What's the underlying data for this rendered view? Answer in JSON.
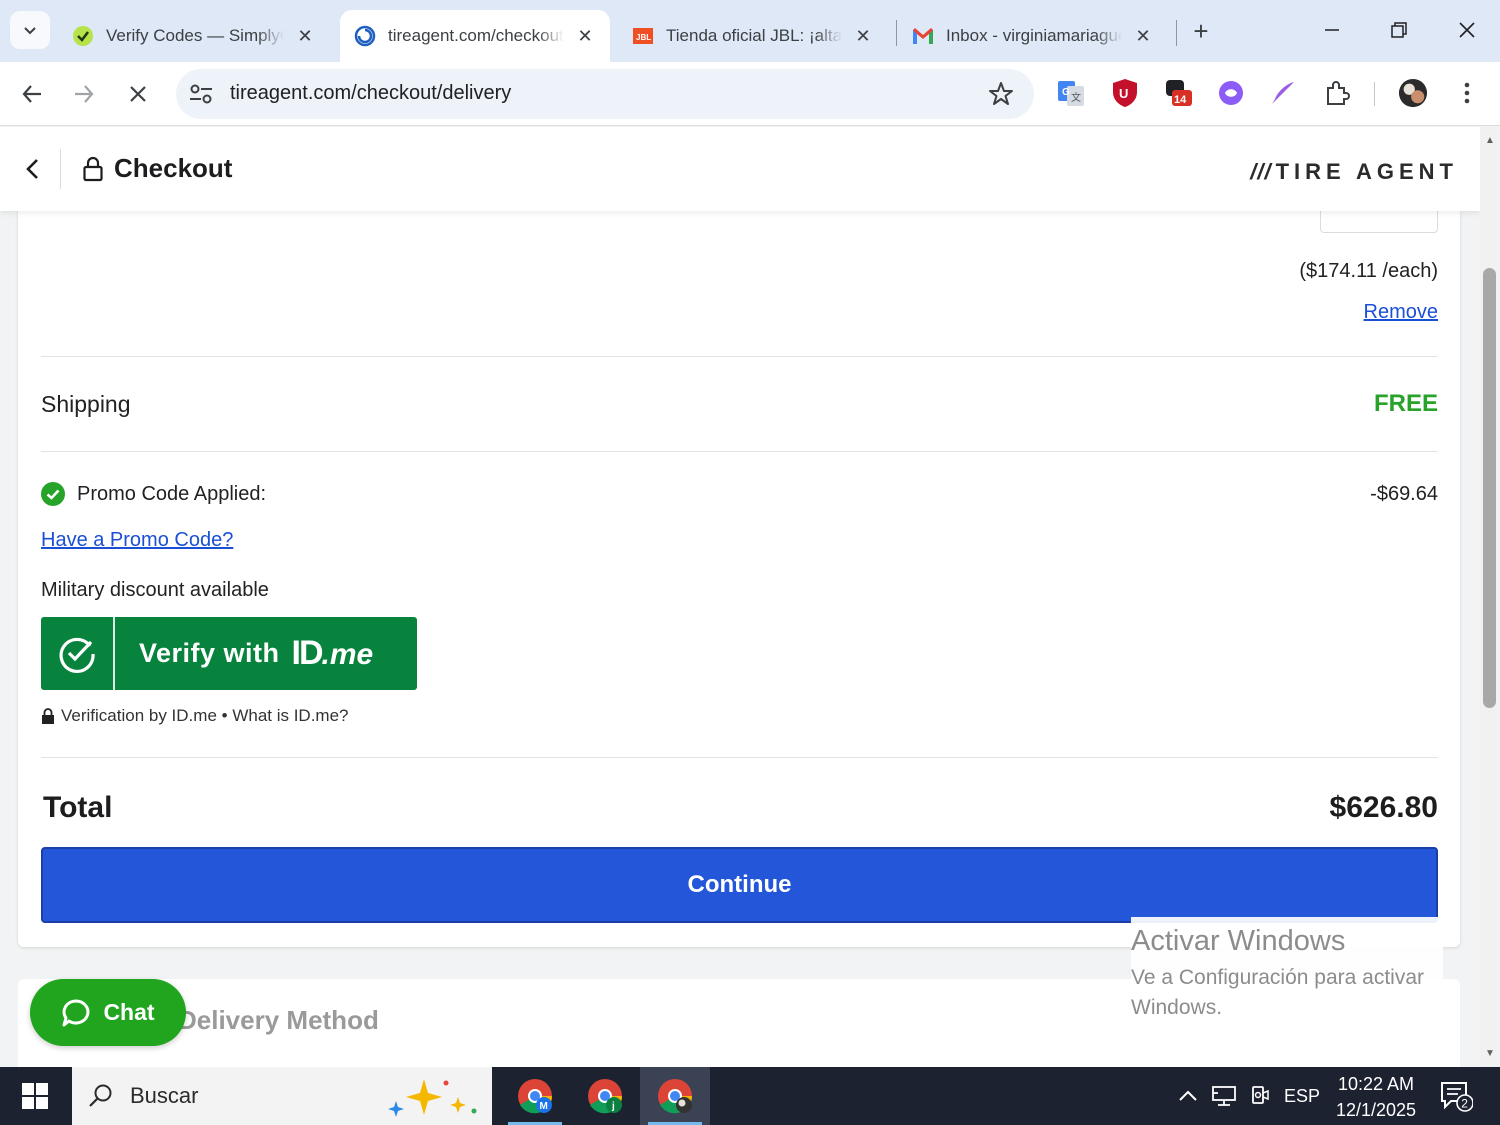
{
  "browser": {
    "tabs": [
      {
        "title": "Verify Codes — SimplyCodes",
        "active": false
      },
      {
        "title": "tireagent.com/checkout/delivery",
        "active": true
      },
      {
        "title": "Tienda oficial JBL: ¡alta calidad!",
        "active": false
      },
      {
        "title": "Inbox - virginiamariague",
        "active": false
      }
    ],
    "url": "tireagent.com/checkout/delivery",
    "extension_badge": "14"
  },
  "header": {
    "title": "Checkout",
    "brand_slashes": "///",
    "brand_name": "TIRE AGENT"
  },
  "order": {
    "price_each": "($174.11 /each)",
    "remove_label": "Remove",
    "shipping_label": "Shipping",
    "shipping_value": "FREE",
    "promo_applied_label": "Promo Code Applied:",
    "promo_amount": "-$69.64",
    "promo_link": "Have a Promo Code?",
    "military_text": "Military discount available",
    "idme_button_label": "Verify with",
    "idme_logo_id": "ID",
    "idme_logo_me": ".me",
    "idme_footer_verification": "Verification by ID.me",
    "idme_footer_sep": " • ",
    "idme_footer_whatis": "What is ID.me?",
    "total_label": "Total",
    "total_value": "$626.80",
    "continue_label": "Continue"
  },
  "next_section": {
    "title": "Delivery Method"
  },
  "chat": {
    "label": "Chat"
  },
  "windows_notice": {
    "title": "Activar Windows",
    "body": "Ve a Configuración para activar Windows."
  },
  "taskbar": {
    "search_placeholder": "Buscar",
    "language": "ESP",
    "time": "10:22 AM",
    "date": "12/1/2025",
    "notifications": "2"
  },
  "colors": {
    "accent_blue": "#2356d8",
    "free_green": "#27a329",
    "idme_green": "#08833d",
    "chat_green": "#21a51f"
  }
}
